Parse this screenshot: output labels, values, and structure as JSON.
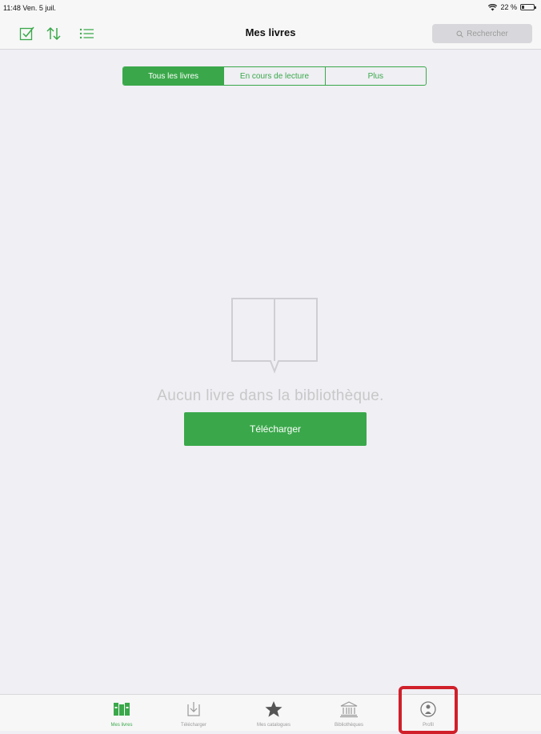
{
  "status_bar": {
    "time": "11:48",
    "date": "Ven. 5 juil.",
    "battery": "22 %",
    "battery_level": 0.22
  },
  "nav": {
    "title": "Mes livres",
    "search_placeholder": "Rechercher",
    "icons": [
      "select-check-icon",
      "sort-arrows-icon",
      "list-view-icon"
    ]
  },
  "segments": [
    {
      "label": "Tous les livres",
      "selected": true
    },
    {
      "label": "En cours de lecture",
      "selected": false
    },
    {
      "label": "Plus",
      "selected": false
    }
  ],
  "empty_state": {
    "message": "Aucun livre dans la bibliothèque.",
    "button_label": "Télécharger"
  },
  "tabs": [
    {
      "label": "Mes livres",
      "icon": "books-icon",
      "active": true
    },
    {
      "label": "Télécharger",
      "icon": "download-icon",
      "active": false
    },
    {
      "label": "Mes catalogues",
      "icon": "star-icon",
      "active": false
    },
    {
      "label": "Bibliothèques",
      "icon": "library-building-icon",
      "active": false
    },
    {
      "label": "Profil",
      "icon": "profile-icon",
      "active": false
    }
  ],
  "colors": {
    "accent": "#3aa84a",
    "highlight": "#d0202a",
    "background": "#efeff4"
  }
}
